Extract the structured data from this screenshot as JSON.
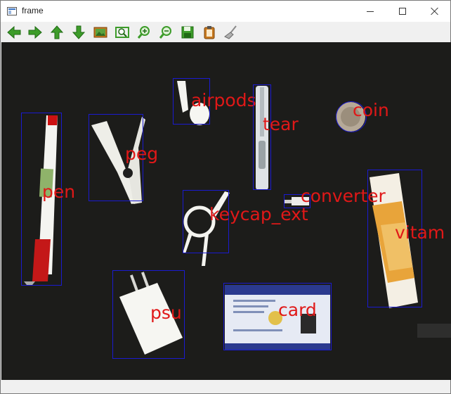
{
  "window": {
    "title": "frame",
    "icon": "opencv-window-icon",
    "controls": [
      "minimize",
      "maximize",
      "close"
    ]
  },
  "toolbar": {
    "buttons": [
      {
        "name": "pan-left",
        "icon": "arrow-left-icon",
        "color": "#3d9c2a"
      },
      {
        "name": "pan-right",
        "icon": "arrow-right-icon",
        "color": "#3d9c2a"
      },
      {
        "name": "pan-up",
        "icon": "arrow-up-icon",
        "color": "#3d9c2a"
      },
      {
        "name": "pan-down",
        "icon": "arrow-down-icon",
        "color": "#3d9c2a"
      },
      {
        "name": "zoom-reset",
        "icon": "image-icon",
        "color": "#c7781e"
      },
      {
        "name": "zoom-fit",
        "icon": "zoom-frame-icon",
        "color": "#3d9c2a"
      },
      {
        "name": "zoom-in",
        "icon": "zoom-in-icon",
        "color": "#3d9c2a"
      },
      {
        "name": "zoom-out",
        "icon": "zoom-out-icon",
        "color": "#3d9c2a"
      },
      {
        "name": "save",
        "icon": "floppy-icon",
        "color": "#3d9c2a"
      },
      {
        "name": "properties",
        "icon": "clipboard-icon",
        "color": "#c7781e"
      },
      {
        "name": "clear",
        "icon": "broom-icon",
        "color": "#8a8a8a"
      }
    ]
  },
  "detections": [
    {
      "label": "pen"
    },
    {
      "label": "peg"
    },
    {
      "label": "airpods"
    },
    {
      "label": "tear"
    },
    {
      "label": "coin"
    },
    {
      "label": "converter"
    },
    {
      "label": "keycap_ext"
    },
    {
      "label": "vitam"
    },
    {
      "label": "psu"
    },
    {
      "label": "card"
    }
  ],
  "colors": {
    "box": "#1a1ad0",
    "label": "#e01818",
    "background": "#1c1c1b"
  }
}
